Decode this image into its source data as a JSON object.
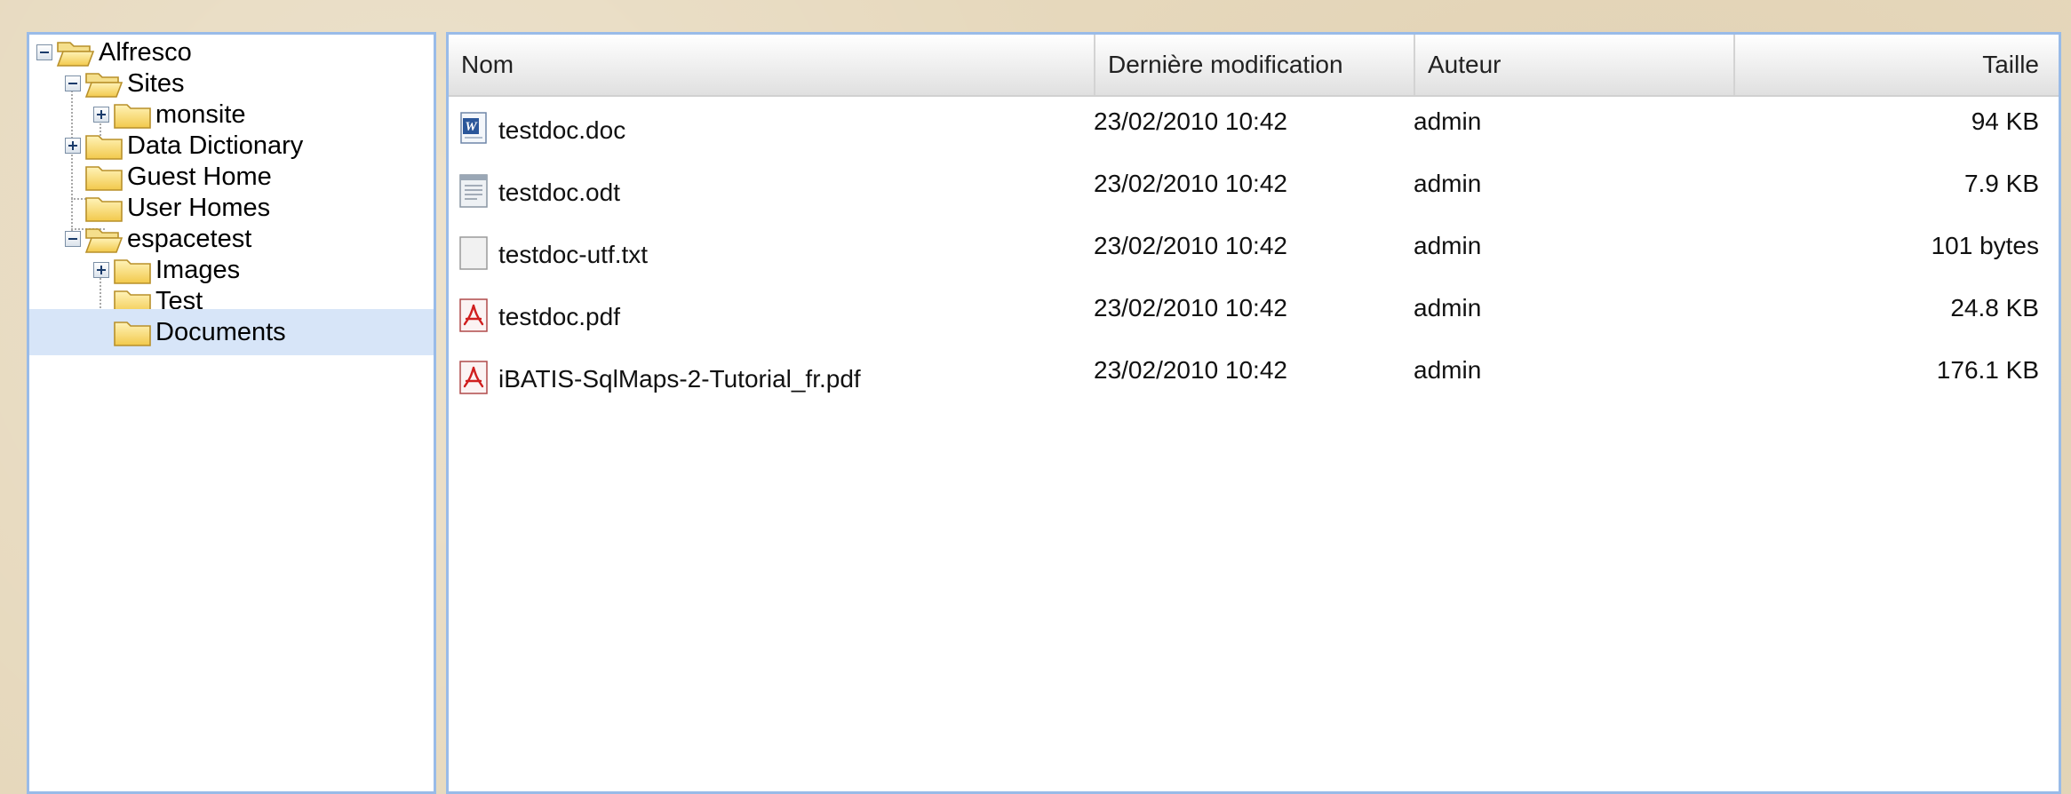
{
  "tree": {
    "nodes": [
      {
        "label": "Alfresco"
      },
      {
        "label": "Sites"
      },
      {
        "label": "monsite"
      },
      {
        "label": "Data Dictionary"
      },
      {
        "label": "Guest Home"
      },
      {
        "label": "User Homes"
      },
      {
        "label": "espacetest"
      },
      {
        "label": "Images"
      },
      {
        "label": "Test"
      },
      {
        "label": "Documents"
      }
    ]
  },
  "grid": {
    "columns": [
      "Nom",
      "Dernière modification",
      "Auteur",
      "Taille"
    ],
    "rows": [
      {
        "name": "testdoc.doc",
        "modified": "23/02/2010 10:42",
        "author": "admin",
        "size": "94 KB",
        "icon": "word-doc-icon"
      },
      {
        "name": "testdoc.odt",
        "modified": "23/02/2010 10:42",
        "author": "admin",
        "size": "7.9 KB",
        "icon": "odt-doc-icon"
      },
      {
        "name": "testdoc-utf.txt",
        "modified": "23/02/2010 10:42",
        "author": "admin",
        "size": "101 bytes",
        "icon": "text-file-icon"
      },
      {
        "name": "testdoc.pdf",
        "modified": "23/02/2010 10:42",
        "author": "admin",
        "size": "24.8 KB",
        "icon": "pdf-file-icon"
      },
      {
        "name": "iBATIS-SqlMaps-2-Tutorial_fr.pdf",
        "modified": "23/02/2010 10:42",
        "author": "admin",
        "size": "176.1 KB",
        "icon": "pdf-file-icon"
      }
    ]
  },
  "colors": {
    "border": "#99bbe8",
    "selected": "#d7e5f8",
    "folder": "#f7d25a"
  }
}
